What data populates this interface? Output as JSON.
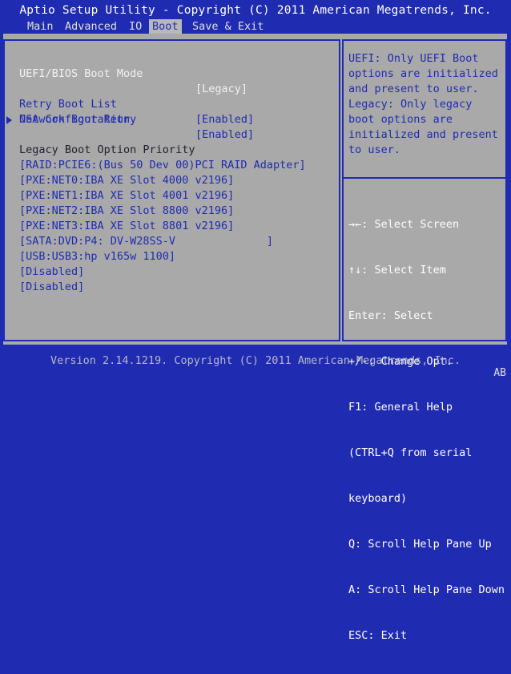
{
  "title": "Aptio Setup Utility - Copyright (C) 2011 American Megatrends, Inc.",
  "menu": {
    "main": "Main",
    "advanced": "Advanced",
    "io": "IO",
    "boot": "Boot",
    "save_exit": "Save & Exit"
  },
  "settings": {
    "boot_mode": {
      "label": "UEFI/BIOS Boot Mode",
      "value": "[Legacy]"
    },
    "retry_boot_list": {
      "label": "Retry Boot List",
      "value": "[Enabled]"
    },
    "network_boot_retry": {
      "label": "Network Boot Retry",
      "value": "[Enabled]"
    },
    "osa_configuration": {
      "label": "OSA Configuration"
    }
  },
  "priority": {
    "heading": "Legacy Boot Option Priority",
    "items": [
      "[RAID:PCIE6:(Bus 50 Dev 00)PCI RAID Adapter]",
      "[PXE:NET0:IBA XE Slot 4000 v2196]",
      "[PXE:NET1:IBA XE Slot 4001 v2196]",
      "[PXE:NET2:IBA XE Slot 8800 v2196]",
      "[PXE:NET3:IBA XE Slot 8801 v2196]",
      "[SATA:DVD:P4: DV-W28SS-V              ]",
      "[USB:USB3:hp v165w 1100]",
      "[Disabled]",
      "[Disabled]"
    ]
  },
  "help": {
    "lines": [
      "UEFI: Only UEFI Boot",
      "options are initialized",
      "and present to user.",
      "Legacy: Only legacy",
      "boot options are",
      "initialized and present",
      "to user."
    ]
  },
  "keys": [
    "→←: Select Screen",
    "↑↓: Select Item",
    "Enter: Select",
    "+/-: Change Opt.",
    "F1: General Help",
    "(CTRL+Q from serial",
    "keyboard)",
    "Q: Scroll Help Pane Up",
    "A: Scroll Help Pane Down",
    "ESC: Exit"
  ],
  "footer": "Version 2.14.1219. Copyright (C) 2011 American Megatrends, Inc.",
  "corner_code": "AB",
  "colors": {
    "background": "#1f2bb0",
    "panel": "#a9a9a9",
    "text_blue": "#1f2bb0",
    "text_white": "#ffffff"
  }
}
